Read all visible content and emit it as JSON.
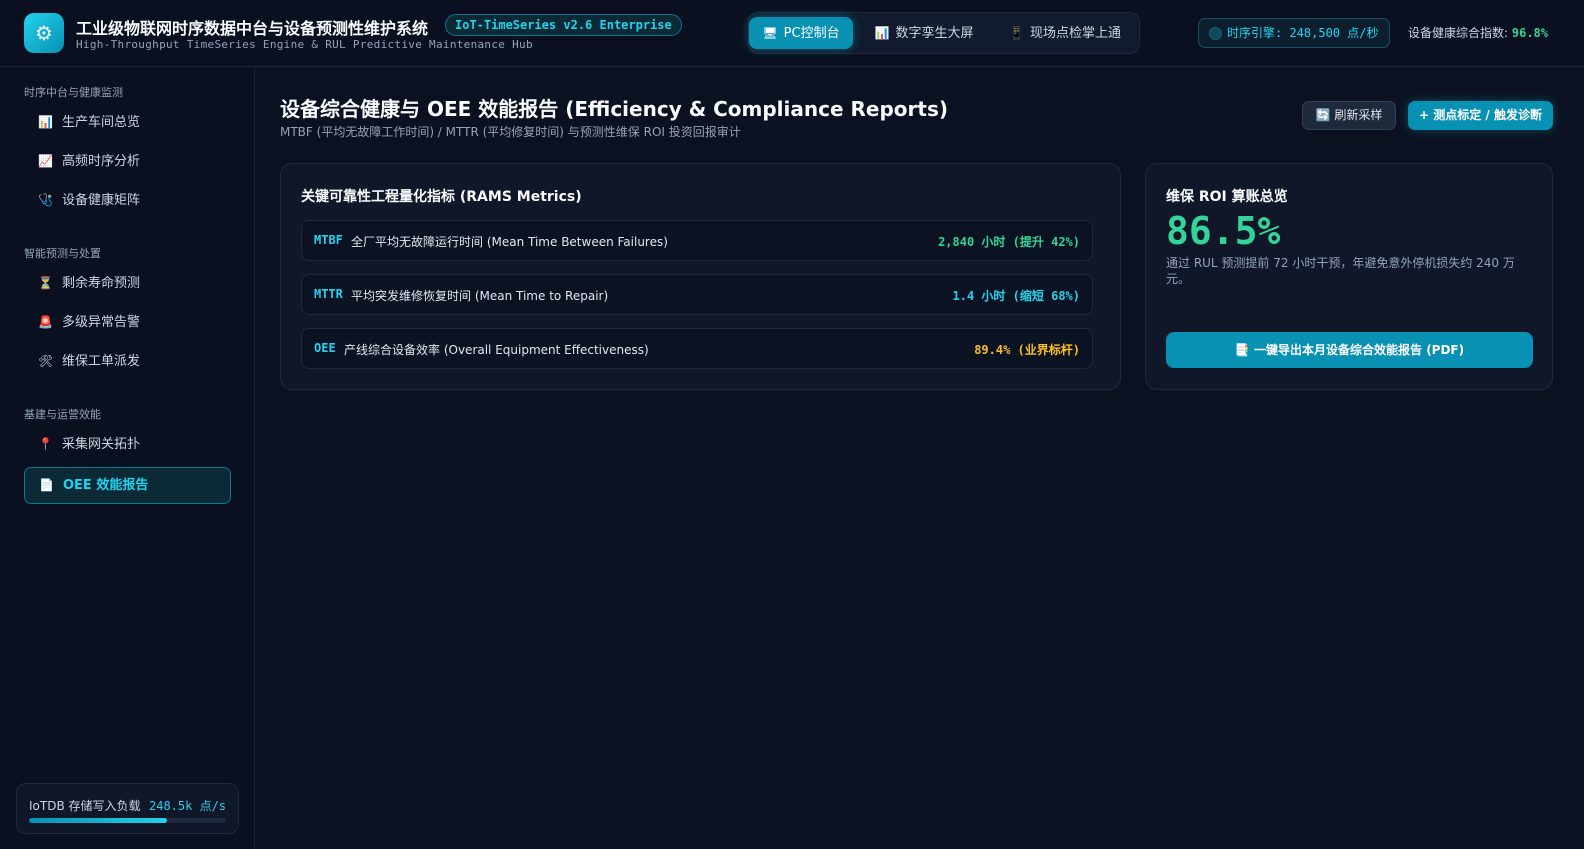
{
  "header": {
    "logo_icon": "gear-icon",
    "title": "工业级物联网时序数据中台与设备预测性维护系统",
    "version_badge": "IoT-TimeSeries v2.6 Enterprise",
    "subtitle": "High-Throughput TimeSeries Engine & RUL Predictive Maintenance Hub",
    "modes": [
      {
        "label": "PC控制台",
        "icon": "monitor-icon",
        "active": true
      },
      {
        "label": "数字孪生大屏",
        "icon": "bar-chart-icon",
        "active": false
      },
      {
        "label": "现场点检掌上通",
        "icon": "mobile-icon",
        "active": false
      }
    ],
    "engine_status": "时序引擎: 248,500 点/秒",
    "health_label": "设备健康综合指数:",
    "health_value": "96.8%"
  },
  "sidebar": {
    "groups": [
      {
        "title": "时序中台与健康监测",
        "items": [
          {
            "label": "生产车间总览",
            "icon": "bar-chart-icon"
          },
          {
            "label": "高频时序分析",
            "icon": "line-chart-icon"
          },
          {
            "label": "设备健康矩阵",
            "icon": "stethoscope-icon"
          }
        ]
      },
      {
        "title": "智能预测与处置",
        "items": [
          {
            "label": "剩余寿命预测",
            "icon": "hourglass-icon"
          },
          {
            "label": "多级异常告警",
            "icon": "alarm-icon"
          },
          {
            "label": "维保工单派发",
            "icon": "tools-icon"
          }
        ]
      },
      {
        "title": "基建与运营效能",
        "items": [
          {
            "label": "采集网关拓扑",
            "icon": "pin-icon"
          },
          {
            "label": "OEE 效能报告",
            "icon": "document-icon",
            "active": true
          }
        ]
      }
    ],
    "storage": {
      "label": "IoTDB 存储写入负载",
      "value": "248.5k 点/s",
      "load_percent": 70
    }
  },
  "main": {
    "title": "设备综合健康与 OEE 效能报告 (Efficiency & Compliance Reports)",
    "subtitle": "MTBF (平均无故障工作时间) / MTTR (平均修复时间) 与预测性维保 ROI 投资回报审计",
    "refresh_label": "刷新采样",
    "refresh_icon": "refresh-icon",
    "primary_label": "+ 测点标定 / 触发诊断",
    "rams": {
      "title": "关键可靠性工程量化指标 (RAMS Metrics)",
      "metrics": [
        {
          "key": "MTBF",
          "desc": "全厂平均无故障运行时间 (Mean Time Between Failures)",
          "value": "2,840 小时 (提升 42%)",
          "color": "#34d399"
        },
        {
          "key": "MTTR",
          "desc": "平均突发维修恢复时间 (Mean Time to Repair)",
          "value": "1.4 小时 (缩短 68%)",
          "color": "#22d3ee"
        },
        {
          "key": "OEE",
          "desc": "产线综合设备效率 (Overall Equipment Effectiveness)",
          "value": "89.4% (业界标杆)",
          "color": "#fbbf24"
        }
      ]
    },
    "roi": {
      "title": "维保 ROI 算账总览",
      "value": "86.5%",
      "desc": "通过 RUL 预测提前 72 小时干预，年避免意外停机损失约 240 万元。",
      "export_label": "一键导出本月设备综合效能报告 (PDF)",
      "export_icon": "file-export-icon"
    }
  }
}
